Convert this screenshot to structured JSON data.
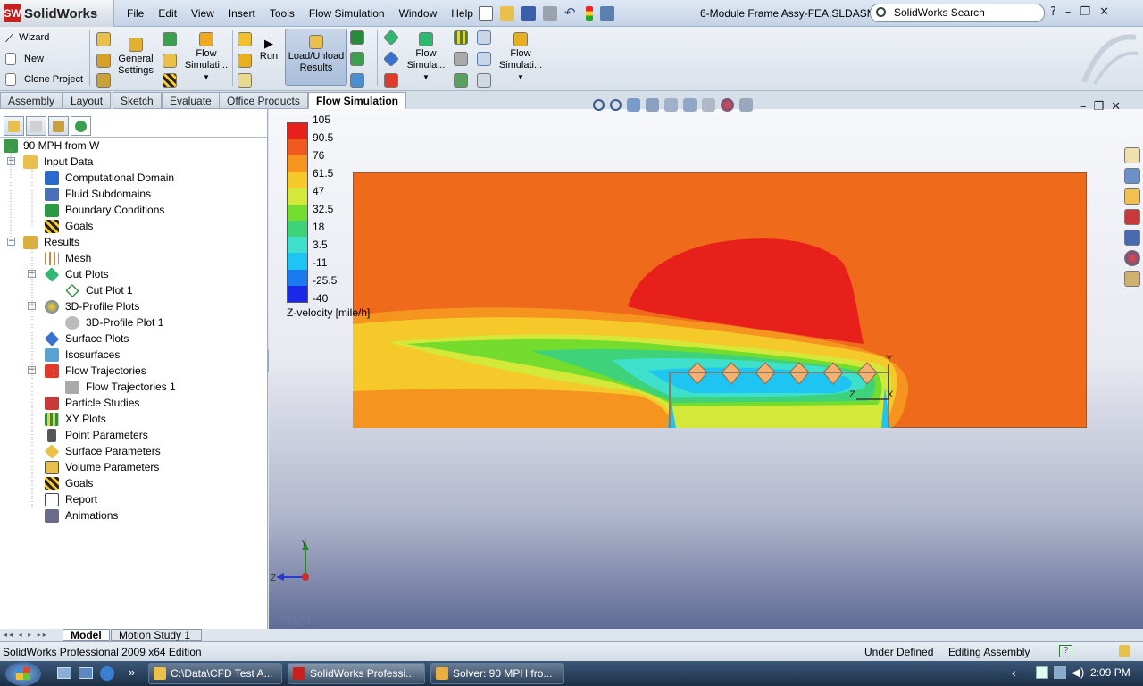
{
  "app": {
    "logo_text": "SolidWorks",
    "logo_badge": "SW"
  },
  "menu": [
    "File",
    "Edit",
    "View",
    "Insert",
    "Tools",
    "Flow Simulation",
    "Window",
    "Help"
  ],
  "document_title": "6-Module Frame Assy-FEA.SLDASM *",
  "search_placeholder": "SolidWorks Search",
  "window_controls": {
    "help": "?",
    "minimize": "–",
    "restore": "❐",
    "close": "✕"
  },
  "commands": {
    "wizard": "Wizard",
    "new": "New",
    "clone_project": "Clone Project",
    "general_settings": [
      "General",
      "Settings"
    ],
    "flow_simulation_1": [
      "Flow",
      "Simulati..."
    ],
    "run": "Run",
    "load_unload": [
      "Load/Unload",
      "Results"
    ],
    "flow_simulation_2": [
      "Flow",
      "Simula..."
    ],
    "flow_simulation_3": [
      "Flow",
      "Simulati..."
    ]
  },
  "cmd_tabs": [
    "Assembly",
    "Layout",
    "Sketch",
    "Evaluate",
    "Office Products",
    "Flow Simulation"
  ],
  "tree": {
    "root": "90 MPH from W",
    "input_data": "Input Data",
    "computational_domain": "Computational Domain",
    "fluid_subdomains": "Fluid Subdomains",
    "boundary_conditions": "Boundary Conditions",
    "goals_input": "Goals",
    "results": "Results",
    "mesh": "Mesh",
    "cut_plots": "Cut Plots",
    "cut_plot_1": "Cut Plot 1",
    "profile_plots": "3D-Profile Plots",
    "profile_plot_1": "3D-Profile Plot 1",
    "surface_plots": "Surface Plots",
    "isosurfaces": "Isosurfaces",
    "flow_trajectories": "Flow Trajectories",
    "flow_trajectories_1": "Flow Trajectories 1",
    "particle_studies": "Particle Studies",
    "xy_plots": "XY Plots",
    "point_parameters": "Point Parameters",
    "surface_parameters": "Surface Parameters",
    "volume_parameters": "Volume Parameters",
    "goals_results": "Goals",
    "report": "Report",
    "animations": "Animations"
  },
  "bottom_tabs": [
    "Model",
    "Motion Study 1"
  ],
  "legend": {
    "ticks": [
      "105",
      "90.5",
      "76",
      "61.5",
      "47",
      "32.5",
      "18",
      "3.5",
      "-11",
      "-25.5",
      "-40"
    ],
    "colors": [
      "#e8201c",
      "#f05a1e",
      "#f59520",
      "#f5c92a",
      "#d4e83a",
      "#74dc2c",
      "#3ed27a",
      "#3ee0cc",
      "#1ec4f2",
      "#1a7af0",
      "#1a28e8"
    ],
    "caption": "Z-velocity [mile/h]"
  },
  "triad": {
    "y": "Y",
    "z": "Z"
  },
  "part_triad": {
    "y": "Y",
    "z": "Z",
    "x": "X"
  },
  "view_label": "*Right",
  "status": {
    "edition": "SolidWorks Professional 2009 x64 Edition",
    "defined": "Under Defined",
    "mode": "Editing Assembly",
    "help": "?"
  },
  "taskbar": {
    "items": [
      "C:\\Data\\CFD Test A...",
      "SolidWorks Professi...",
      "Solver: 90 MPH fro..."
    ],
    "overflow": "»",
    "tray_arrow": "‹",
    "clock": "2:09 PM"
  },
  "colors": {
    "bg_flow": "#ef6a1a",
    "accent_red": "#c8201e"
  }
}
